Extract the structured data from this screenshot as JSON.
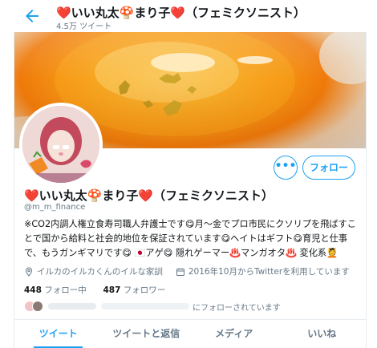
{
  "header": {
    "title": "❤️いい丸太🍄まり子❤️（フェミクソニスト）",
    "tweet_count": "4.5万 ツイート"
  },
  "profile": {
    "name": "❤️いい丸太🍄まり子❤️（フェミクソニスト）",
    "handle": "@m_m_finance",
    "bio": "※CO2内調人権立食寿司職人弁護士です😋月〜金でプロ市民にクソリプを飛ばすことで国から給料と社会的地位を保証されています😋ヘイトはギフト😋育児と仕事で、もうガンギマリです😋 🇯🇵アゲ😋 隠れゲーマー♨️マンガオタ♨️ 変化系💆",
    "location": "イルカのイルカくんのイルな家訓",
    "joined": "2016年10月からTwitterを利用しています",
    "following_count": "448",
    "following_label": "フォロー中",
    "followers_count": "487",
    "followers_label": "フォロワー",
    "followed_by_text": "にフォローされています"
  },
  "actions": {
    "more_label": "•••",
    "follow_label": "フォロー"
  },
  "tabs": [
    {
      "label": "ツイート",
      "active": true
    },
    {
      "label": "ツイートと返信",
      "active": false
    },
    {
      "label": "メディア",
      "active": false
    },
    {
      "label": "いいね",
      "active": false
    }
  ],
  "colors": {
    "accent": "#1da1f2",
    "text": "#14171a",
    "secondary": "#657786"
  }
}
